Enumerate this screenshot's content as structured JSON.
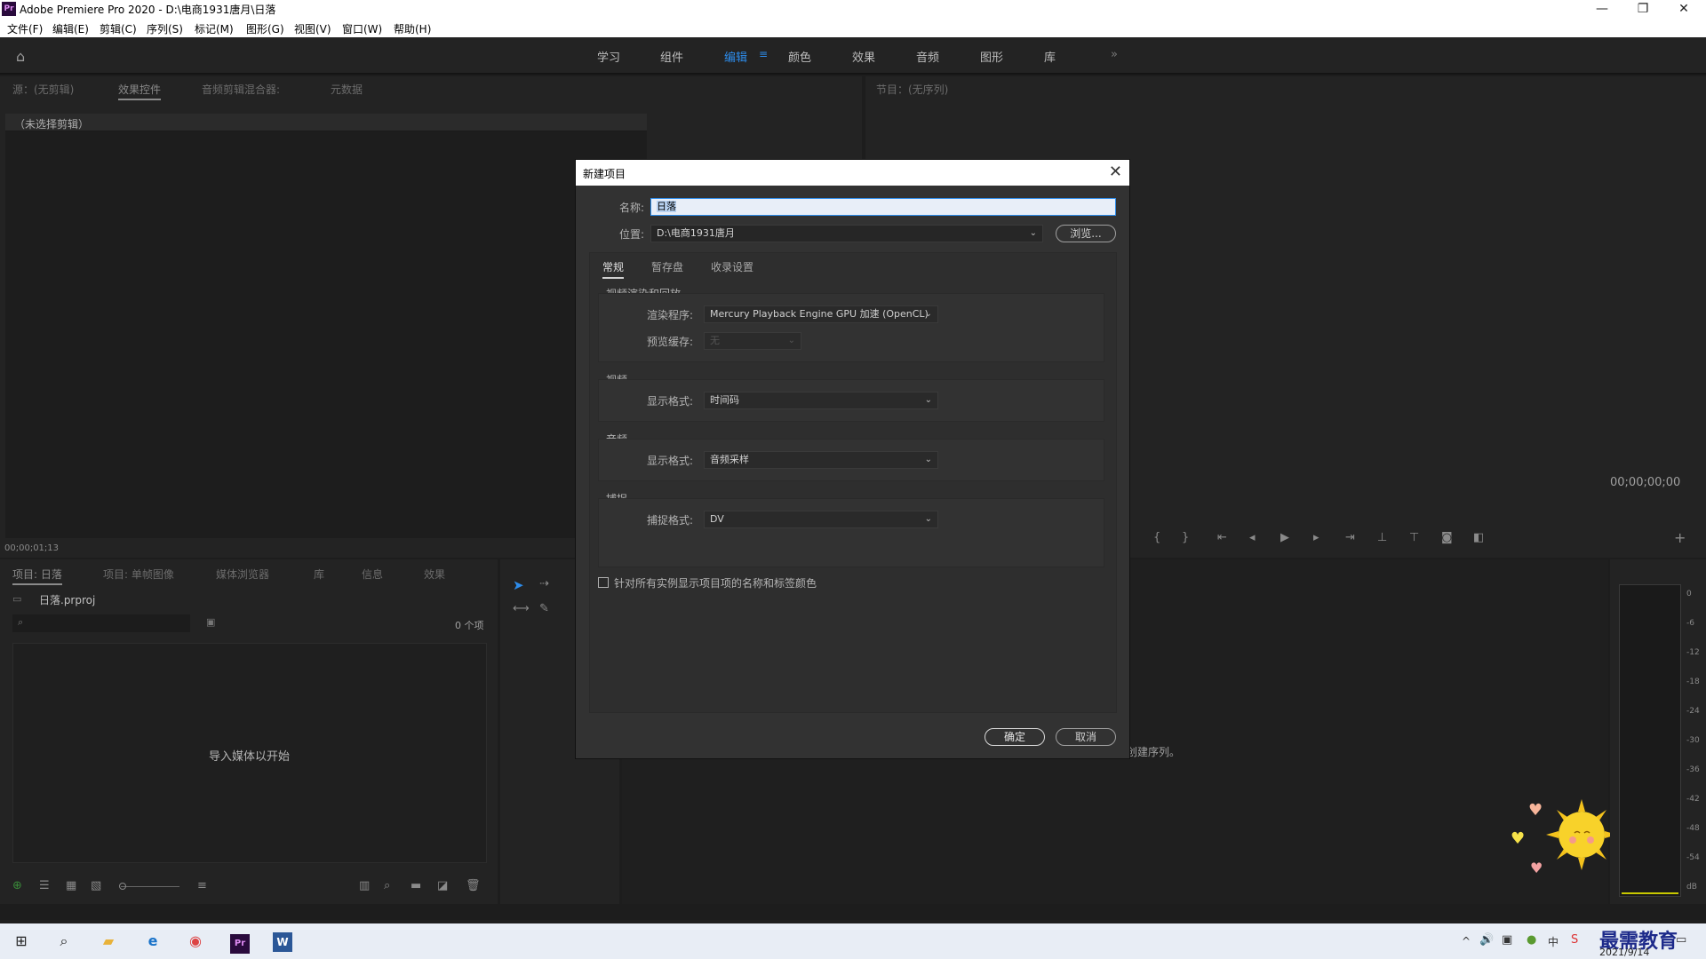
{
  "window": {
    "app_icon": "Pr",
    "title": "Adobe Premiere Pro 2020 - D:\\电商1931唐月\\日落",
    "minimize": "—",
    "restore": "❐",
    "close": "✕"
  },
  "menu": [
    "文件(F)",
    "编辑(E)",
    "剪辑(C)",
    "序列(S)",
    "标记(M)",
    "图形(G)",
    "视图(V)",
    "窗口(W)",
    "帮助(H)"
  ],
  "workspaces": [
    "学习",
    "组件",
    "编辑",
    "颜色",
    "效果",
    "音频",
    "图形",
    "库"
  ],
  "workspace_active": "编辑",
  "workspace_more": "»",
  "source_panel": {
    "tabs": [
      "源：(无剪辑)",
      "效果控件",
      "音频剪辑混合器:",
      "元数据"
    ],
    "no_clip": "（未选择剪辑）",
    "timecode": "00;00;01;13"
  },
  "program_panel": {
    "tab": "节目：(无序列)",
    "timecode": "00;00;00;00"
  },
  "project_panel": {
    "tabs": [
      "项目: 日落",
      "项目: 单帧图像",
      "媒体浏览器",
      "库",
      "信息",
      "效果"
    ],
    "file": "日落.prproj",
    "count": "0 个项",
    "empty_msg": "导入媒体以开始"
  },
  "timeline": {
    "hint": "创建序列。"
  },
  "meter": {
    "ticks": [
      "0",
      "-6",
      "-12",
      "-18",
      "-24",
      "-30",
      "-36",
      "-42",
      "-48",
      "-54",
      "dB"
    ]
  },
  "dialog": {
    "title": "新建项目",
    "close": "✕",
    "name_label": "名称:",
    "name_value": "日落",
    "location_label": "位置:",
    "location_value": "D:\\电商1931唐月",
    "browse": "浏览...",
    "tabs": [
      "常规",
      "暂存盘",
      "收录设置"
    ],
    "active_tab": "常规",
    "sections": {
      "render": {
        "title": "视频渲染和回放",
        "renderer_label": "渲染程序:",
        "renderer_value": "Mercury Playback Engine GPU 加速 (OpenCL)",
        "preview_label": "预览缓存:",
        "preview_value": "无"
      },
      "video": {
        "title": "视频",
        "format_label": "显示格式:",
        "format_value": "时间码"
      },
      "audio": {
        "title": "音频",
        "format_label": "显示格式:",
        "format_value": "音频采样"
      },
      "capture": {
        "title": "捕捉",
        "format_label": "捕捉格式:",
        "format_value": "DV"
      }
    },
    "checkbox_label": "针对所有实例显示项目项的名称和标签颜色",
    "ok": "确定",
    "cancel": "取消"
  },
  "taskbar": {
    "date": "2021/9/14",
    "watermark": "最需教育",
    "ime": "中",
    "apps": [
      "windows-icon",
      "search-icon",
      "file-explorer-icon",
      "edge-icon",
      "chrome-icon",
      "premiere-icon",
      "word-icon"
    ]
  },
  "colors": {
    "accent_blue": "#2d8ceb",
    "panel_bg": "#232323",
    "dialog_bg": "#323232",
    "premiere_purple": "#2a0b3d"
  }
}
